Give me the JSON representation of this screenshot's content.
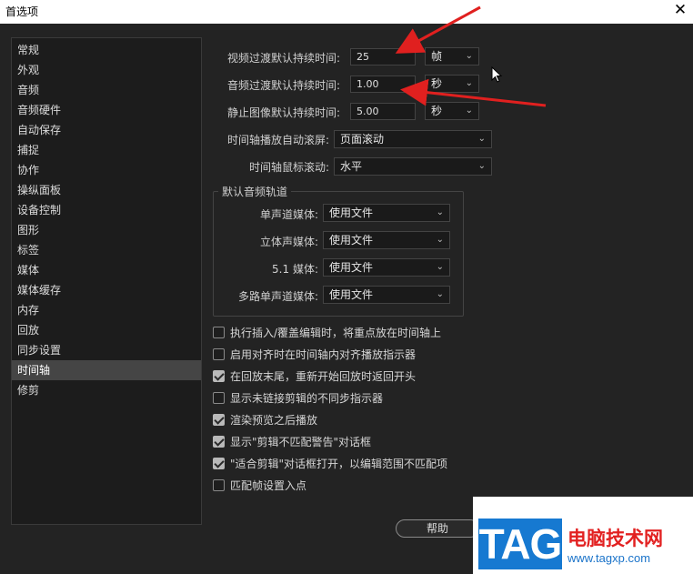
{
  "window": {
    "title": "首选项",
    "close_glyph": "✕"
  },
  "sidebar": {
    "items": [
      {
        "label": "常规"
      },
      {
        "label": "外观"
      },
      {
        "label": "音频"
      },
      {
        "label": "音频硬件"
      },
      {
        "label": "自动保存"
      },
      {
        "label": "捕捉"
      },
      {
        "label": "协作"
      },
      {
        "label": "操纵面板"
      },
      {
        "label": "设备控制"
      },
      {
        "label": "图形"
      },
      {
        "label": "标签"
      },
      {
        "label": "媒体"
      },
      {
        "label": "媒体缓存"
      },
      {
        "label": "内存"
      },
      {
        "label": "回放"
      },
      {
        "label": "同步设置"
      },
      {
        "label": "时间轴"
      },
      {
        "label": "修剪"
      }
    ],
    "selected": "时间轴"
  },
  "durations": {
    "video_label": "视频过渡默认持续时间:",
    "video_value": "25",
    "video_unit": "帧",
    "audio_label": "音频过渡默认持续时间:",
    "audio_value": "1.00",
    "audio_unit": "秒",
    "still_label": "静止图像默认持续时间:",
    "still_value": "5.00",
    "still_unit": "秒"
  },
  "scroll": {
    "playback_label": "时间轴播放自动滚屏:",
    "playback_value": "页面滚动",
    "mouse_label": "时间轴鼠标滚动:",
    "mouse_value": "水平"
  },
  "audio_tracks": {
    "title": "默认音频轨道",
    "mono_label": "单声道媒体:",
    "mono_value": "使用文件",
    "stereo_label": "立体声媒体:",
    "stereo_value": "使用文件",
    "five_one_label": "5.1 媒体:",
    "five_one_value": "使用文件",
    "multi_mono_label": "多路单声道媒体:",
    "multi_mono_value": "使用文件"
  },
  "options": [
    {
      "label": "执行插入/覆盖编辑时，将重点放在时间轴上",
      "checked": false
    },
    {
      "label": "启用对齐时在时间轴内对齐播放指示器",
      "checked": false
    },
    {
      "label": "在回放末尾，重新开始回放时返回开头",
      "checked": true
    },
    {
      "label": "显示未链接剪辑的不同步指示器",
      "checked": false
    },
    {
      "label": "渲染预览之后播放",
      "checked": true
    },
    {
      "label": "显示\"剪辑不匹配警告\"对话框",
      "checked": true
    },
    {
      "label": "\"适合剪辑\"对话框打开，以编辑范围不匹配项",
      "checked": true
    },
    {
      "label": "匹配帧设置入点",
      "checked": false
    }
  ],
  "footer": {
    "help_label": "帮助"
  },
  "watermark": {
    "tag": "TAG",
    "site_name": "电脑技术网",
    "url": "www.tagxp.com"
  },
  "colors": {
    "accent_arrow": "#e0201f",
    "tag_blue": "#1679d1"
  }
}
